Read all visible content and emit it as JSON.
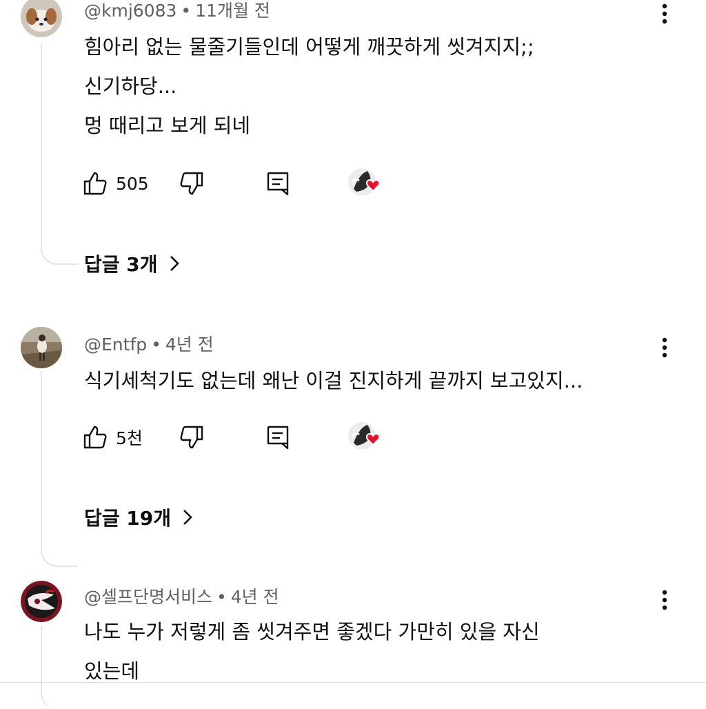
{
  "comments": [
    {
      "handle": "@kmj6083",
      "time": "11개월 전",
      "lines": [
        "힘아리 없는 물줄기들인데 어떻게 깨끗하게 씻겨지지;;",
        "신기하당...",
        "멍 때리고 보게 되네"
      ],
      "likes": "505",
      "replies_label": "답글 3개"
    },
    {
      "handle": "@Entfp",
      "time": "4년 전",
      "lines": [
        "식기세척기도 없는데 왜난 이걸 진지하게 끝까지 보고있지..."
      ],
      "likes": "5천",
      "replies_label": "답글 19개"
    },
    {
      "handle": "@셀프단명서비스",
      "time": "4년 전",
      "lines": [
        "나도 누가 저렇게 좀 씻겨주면 좋겠다 가만히 있을 자신",
        "있는데"
      ]
    }
  ],
  "separator": "•",
  "icons": {
    "like": "thumb-up-icon",
    "dislike": "thumb-down-icon",
    "reply": "comment-reply-icon",
    "more": "more-vert-icon",
    "creator_heart": "creator-heart-icon",
    "chevron": "chevron-right-icon"
  },
  "colors": {
    "heart": "#e8112d",
    "meta": "#606060",
    "thread_line": "#e5e5e5"
  }
}
